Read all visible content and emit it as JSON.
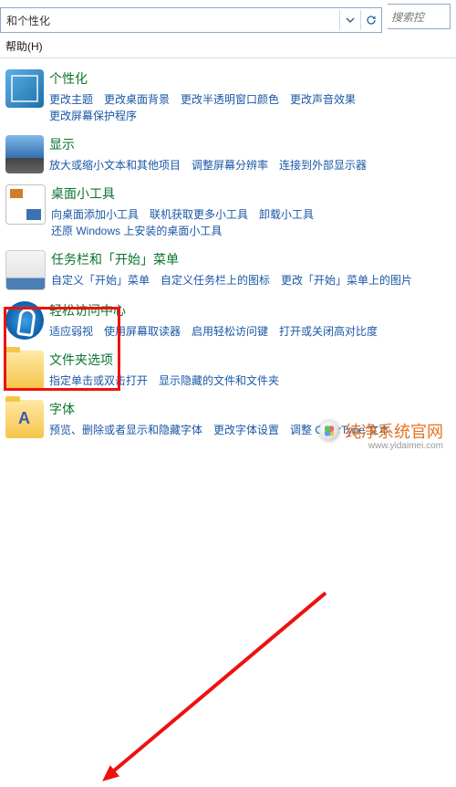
{
  "address_bar": {
    "path": "和个性化",
    "search_placeholder": "搜索控"
  },
  "menu": {
    "help": "帮助(H)"
  },
  "sections": [
    {
      "title": "个性化",
      "links": [
        "更改主题",
        "更改桌面背景",
        "更改半透明窗口颜色",
        "更改声音效果",
        "更改屏幕保护程序"
      ]
    },
    {
      "title": "显示",
      "links": [
        "放大或缩小文本和其他项目",
        "调整屏幕分辨率",
        "连接到外部显示器"
      ]
    },
    {
      "title": "桌面小工具",
      "links": [
        "向桌面添加小工具",
        "联机获取更多小工具",
        "卸载小工具",
        "还原 Windows 上安装的桌面小工具"
      ]
    },
    {
      "title": "任务栏和「开始」菜单",
      "links": [
        "自定义「开始」菜单",
        "自定义任务栏上的图标",
        "更改「开始」菜单上的图片"
      ]
    },
    {
      "title": "轻松访问中心",
      "links": [
        "适应弱视",
        "使用屏幕取读器",
        "启用轻松访问键",
        "打开或关闭高对比度"
      ]
    },
    {
      "title": "文件夹选项",
      "links": [
        "指定单击或双击打开",
        "显示隐藏的文件和文件夹"
      ]
    },
    {
      "title": "字体",
      "links": [
        "预览、删除或者显示和隐藏字体",
        "更改字体设置",
        "调整 ClearType 文本"
      ]
    }
  ],
  "watermark": {
    "line1": "纯净系统官网",
    "line2": "www.yidaimei.com"
  }
}
